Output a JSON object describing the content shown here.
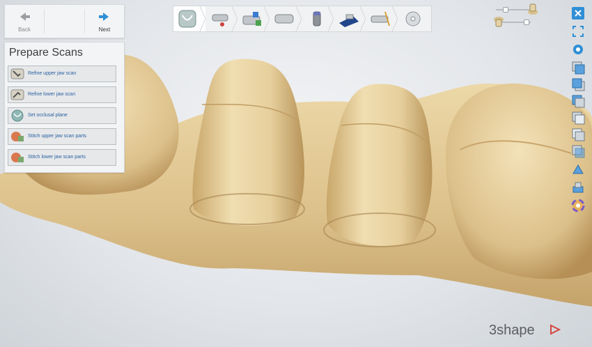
{
  "nav": {
    "back_label": "Back",
    "next_label": "Next"
  },
  "panel": {
    "title": "Prepare Scans",
    "steps": [
      {
        "label": "Refine upper jaw scan",
        "icon": "refine-upper-jaw-icon"
      },
      {
        "label": "Refine lower jaw scan",
        "icon": "refine-lower-jaw-icon"
      },
      {
        "label": "Set occlusal plane",
        "icon": "occlusal-plane-icon"
      },
      {
        "label": "Stitch upper jaw scan parts",
        "icon": "stitch-upper-jaw-icon"
      },
      {
        "label": "Stitch lower jaw scan parts",
        "icon": "stitch-lower-jaw-icon"
      }
    ]
  },
  "toolbar": {
    "items": [
      "prepare-scans-icon",
      "cut-model-icon",
      "segment-dies-icon",
      "trim-model-icon",
      "design-die-icon",
      "base-icon",
      "sectioning-icon",
      "save-disc-icon"
    ],
    "active_index": 0
  },
  "right_tools": [
    "close-icon",
    "fullscreen-icon",
    "settings-icon",
    "view-front-icon",
    "view-back-icon",
    "view-left-icon",
    "view-right-icon",
    "view-top-icon",
    "view-bottom-icon",
    "view-iso-icon",
    "color-icon"
  ],
  "logo": {
    "text": "3shape"
  },
  "colors": {
    "model": "#e9d4a1",
    "model_shadow": "#b9955a",
    "accent_blue": "#2f8fd6",
    "link_blue": "#2a5fa0"
  }
}
